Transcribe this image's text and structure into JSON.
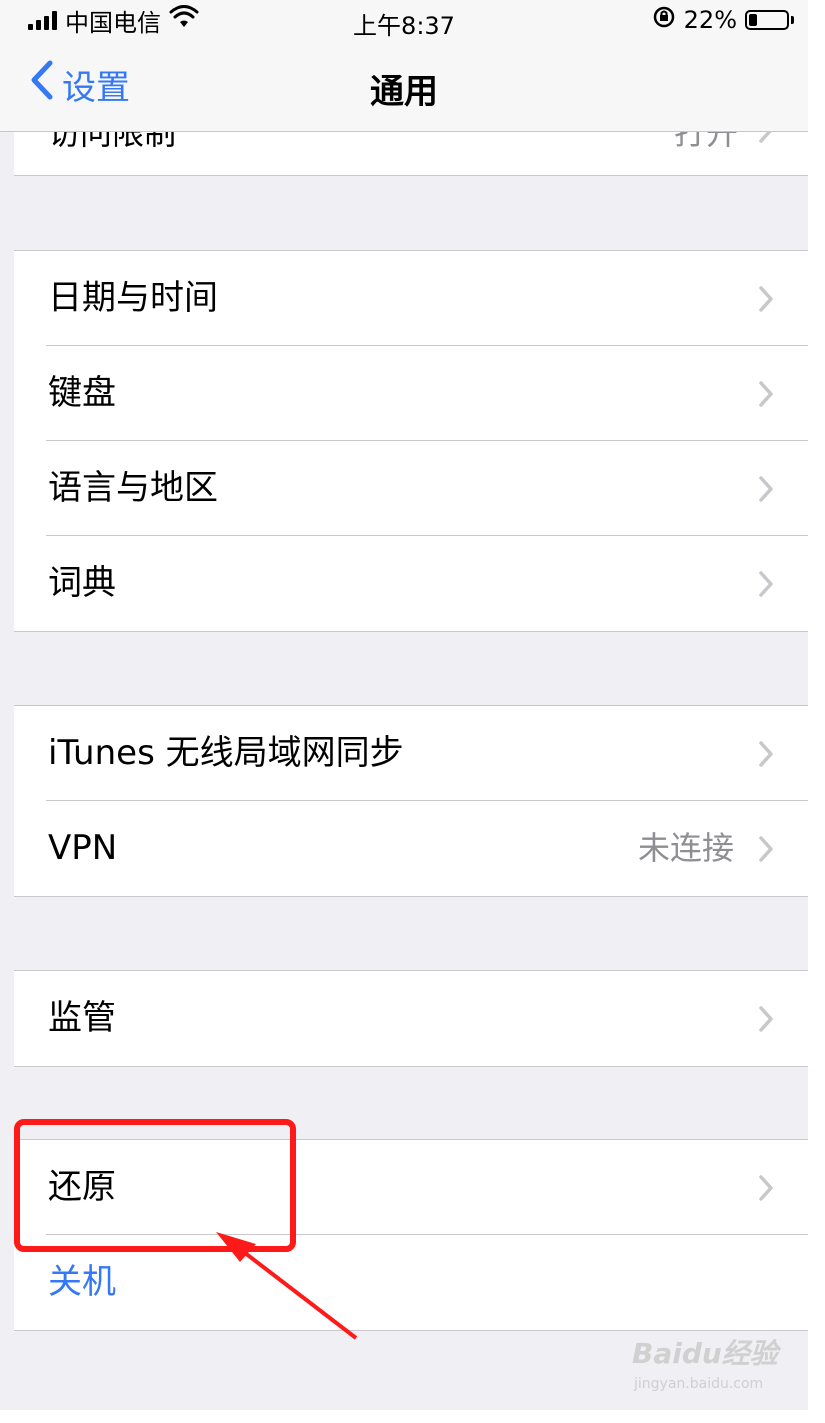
{
  "status_bar": {
    "carrier": "中国电信",
    "time": "上午8:37",
    "battery_percent": "22%",
    "battery_level": 0.22
  },
  "nav": {
    "back_label": "设置",
    "title": "通用"
  },
  "partial_row": {
    "label": "访问限制",
    "value": "打开"
  },
  "groups": [
    {
      "rows": [
        {
          "label": "日期与时间"
        },
        {
          "label": "键盘"
        },
        {
          "label": "语言与地区"
        },
        {
          "label": "词典"
        }
      ]
    },
    {
      "rows": [
        {
          "label": "iTunes 无线局域网同步"
        },
        {
          "label": "VPN",
          "value": "未连接"
        }
      ]
    },
    {
      "rows": [
        {
          "label": "监管"
        }
      ]
    },
    {
      "rows": [
        {
          "label": "还原"
        },
        {
          "label": "关机"
        }
      ]
    }
  ],
  "watermark": {
    "main": "Baidu经验",
    "sub": "jingyan.baidu.com"
  },
  "colors": {
    "accent": "#3478f6",
    "highlight": "#ff1a1a",
    "background": "#efeff4"
  },
  "icons": [
    "signal-icon",
    "wifi-icon",
    "orientation-lock-icon",
    "battery-icon",
    "back-chevron-icon",
    "chevron-right-icon"
  ]
}
